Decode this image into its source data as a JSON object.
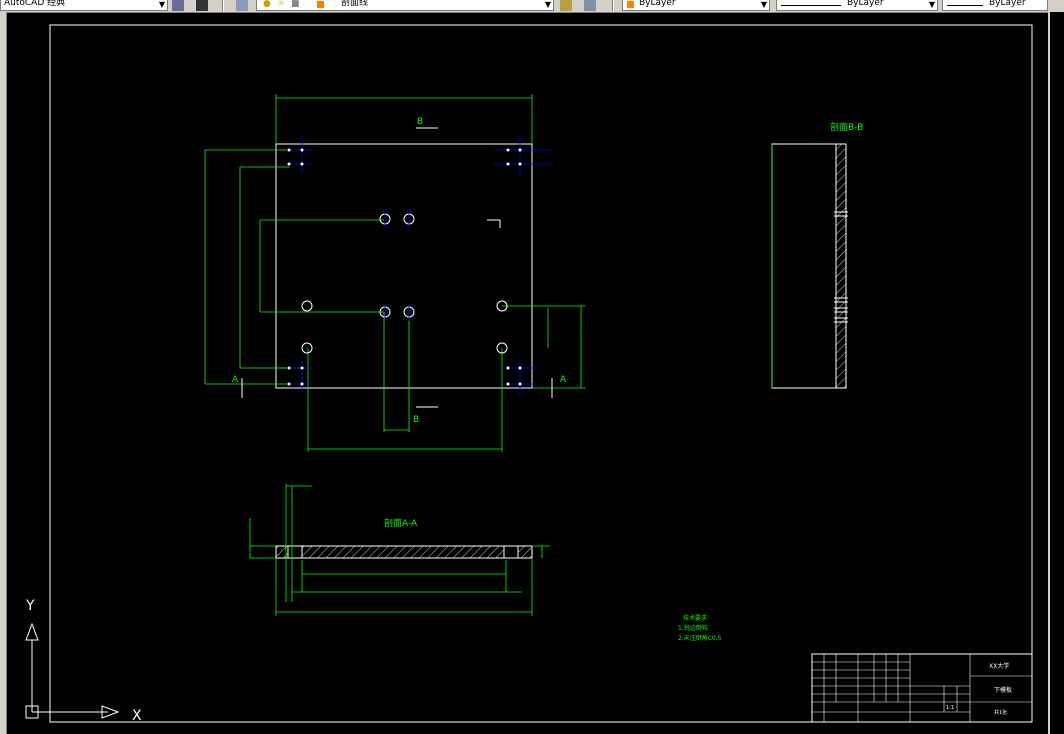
{
  "toolbar": {
    "workspace": "AutoCAD 经典",
    "layer_name": "剖面线",
    "color": "ByLayer",
    "linetype": "ByLayer",
    "lineweight": "ByLayer",
    "color_swatch": "#ff8000"
  },
  "drawing": {
    "section_bb_title": "剖面B-B",
    "section_aa_title": "剖面A-A",
    "section_label_b": "B",
    "section_label_a": "A",
    "notes_title": "技术要求",
    "note_1": "1.锐边倒钝",
    "note_2": "2.未注倒角C0.5",
    "line_color": "#00ff00",
    "outline_color": "#ffffff",
    "center_color": "#0000ff"
  },
  "title_block": {
    "school": "XX大学",
    "part_name": "下模板",
    "scale": "1:1",
    "sheet": "共1张"
  },
  "ucs": {
    "x_label": "X",
    "y_label": "Y"
  }
}
